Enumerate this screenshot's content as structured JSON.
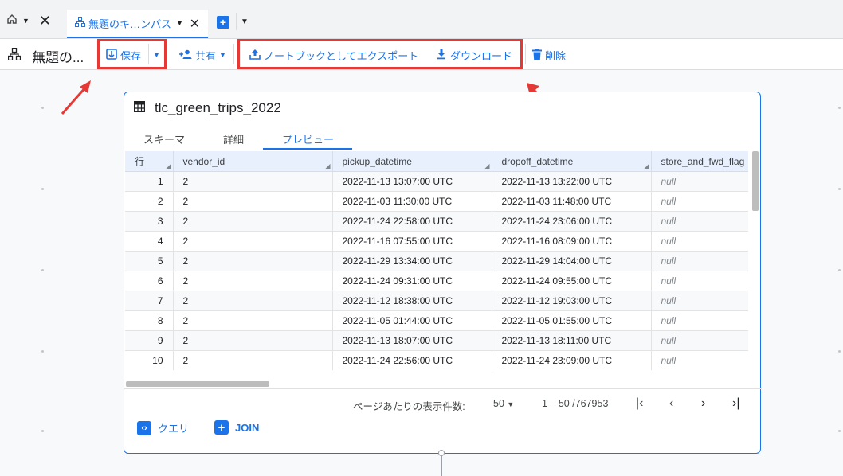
{
  "tabs": {
    "active_label": "無題のキ…ンパス"
  },
  "toolbar": {
    "title": "無題の...",
    "save_label": "保存",
    "share_label": "共有",
    "export_label": "ノートブックとしてエクスポート",
    "download_label": "ダウンロード",
    "delete_label": "削除"
  },
  "card": {
    "title": "tlc_green_trips_2022",
    "tabs": [
      "スキーマ",
      "詳細",
      "プレビュー"
    ],
    "active_tab": "プレビュー"
  },
  "grid": {
    "columns": [
      "行",
      "vendor_id",
      "pickup_datetime",
      "dropoff_datetime",
      "store_and_fwd_flag"
    ],
    "rows": [
      [
        "1",
        "2",
        "2022-11-13 13:07:00 UTC",
        "2022-11-13 13:22:00 UTC",
        "null"
      ],
      [
        "2",
        "2",
        "2022-11-03 11:30:00 UTC",
        "2022-11-03 11:48:00 UTC",
        "null"
      ],
      [
        "3",
        "2",
        "2022-11-24 22:58:00 UTC",
        "2022-11-24 23:06:00 UTC",
        "null"
      ],
      [
        "4",
        "2",
        "2022-11-16 07:55:00 UTC",
        "2022-11-16 08:09:00 UTC",
        "null"
      ],
      [
        "5",
        "2",
        "2022-11-29 13:34:00 UTC",
        "2022-11-29 14:04:00 UTC",
        "null"
      ],
      [
        "6",
        "2",
        "2022-11-24 09:31:00 UTC",
        "2022-11-24 09:55:00 UTC",
        "null"
      ],
      [
        "7",
        "2",
        "2022-11-12 18:38:00 UTC",
        "2022-11-12 19:03:00 UTC",
        "null"
      ],
      [
        "8",
        "2",
        "2022-11-05 01:44:00 UTC",
        "2022-11-05 01:55:00 UTC",
        "null"
      ],
      [
        "9",
        "2",
        "2022-11-13 18:07:00 UTC",
        "2022-11-13 18:11:00 UTC",
        "null"
      ],
      [
        "10",
        "2",
        "2022-11-24 22:56:00 UTC",
        "2022-11-24 23:09:00 UTC",
        "null"
      ]
    ]
  },
  "pager": {
    "rows_per_page_label": "ページあたりの表示件数:",
    "rows_per_page_value": "50",
    "range": "1 – 50 /767953"
  },
  "actions": {
    "query_label": "クエリ",
    "join_label": "JOIN"
  },
  "colors": {
    "accent": "#1a73e8",
    "highlight_box": "#e53935"
  }
}
